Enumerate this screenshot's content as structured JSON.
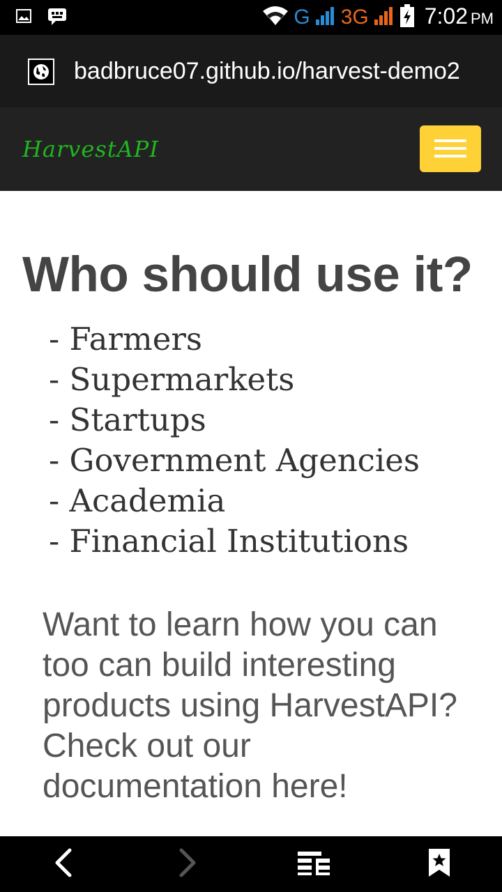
{
  "status_bar": {
    "network_g": "G",
    "network_3g": "3G",
    "time": "7:02",
    "ampm": "PM"
  },
  "address_bar": {
    "url": "badbruce07.github.io/harvest-demo2"
  },
  "navbar": {
    "brand": "HarvestAPI",
    "toggle_color": "#fed136",
    "brand_color": "#21b521"
  },
  "content": {
    "heading": "Who should use it?",
    "audience": [
      "- Farmers",
      "- Supermarkets",
      "- Startups",
      "- Government Agencies",
      "- Academia",
      "- Financial Institutions"
    ],
    "cta_lines": [
      "Want to learn how you can",
      "too can build interesting",
      "products using HarvestAPI?",
      "Check out our",
      "documentation here!"
    ]
  },
  "bottom_bar": {
    "icons": [
      "back-icon",
      "forward-icon",
      "tabs-icon",
      "bookmarks-icon"
    ]
  }
}
